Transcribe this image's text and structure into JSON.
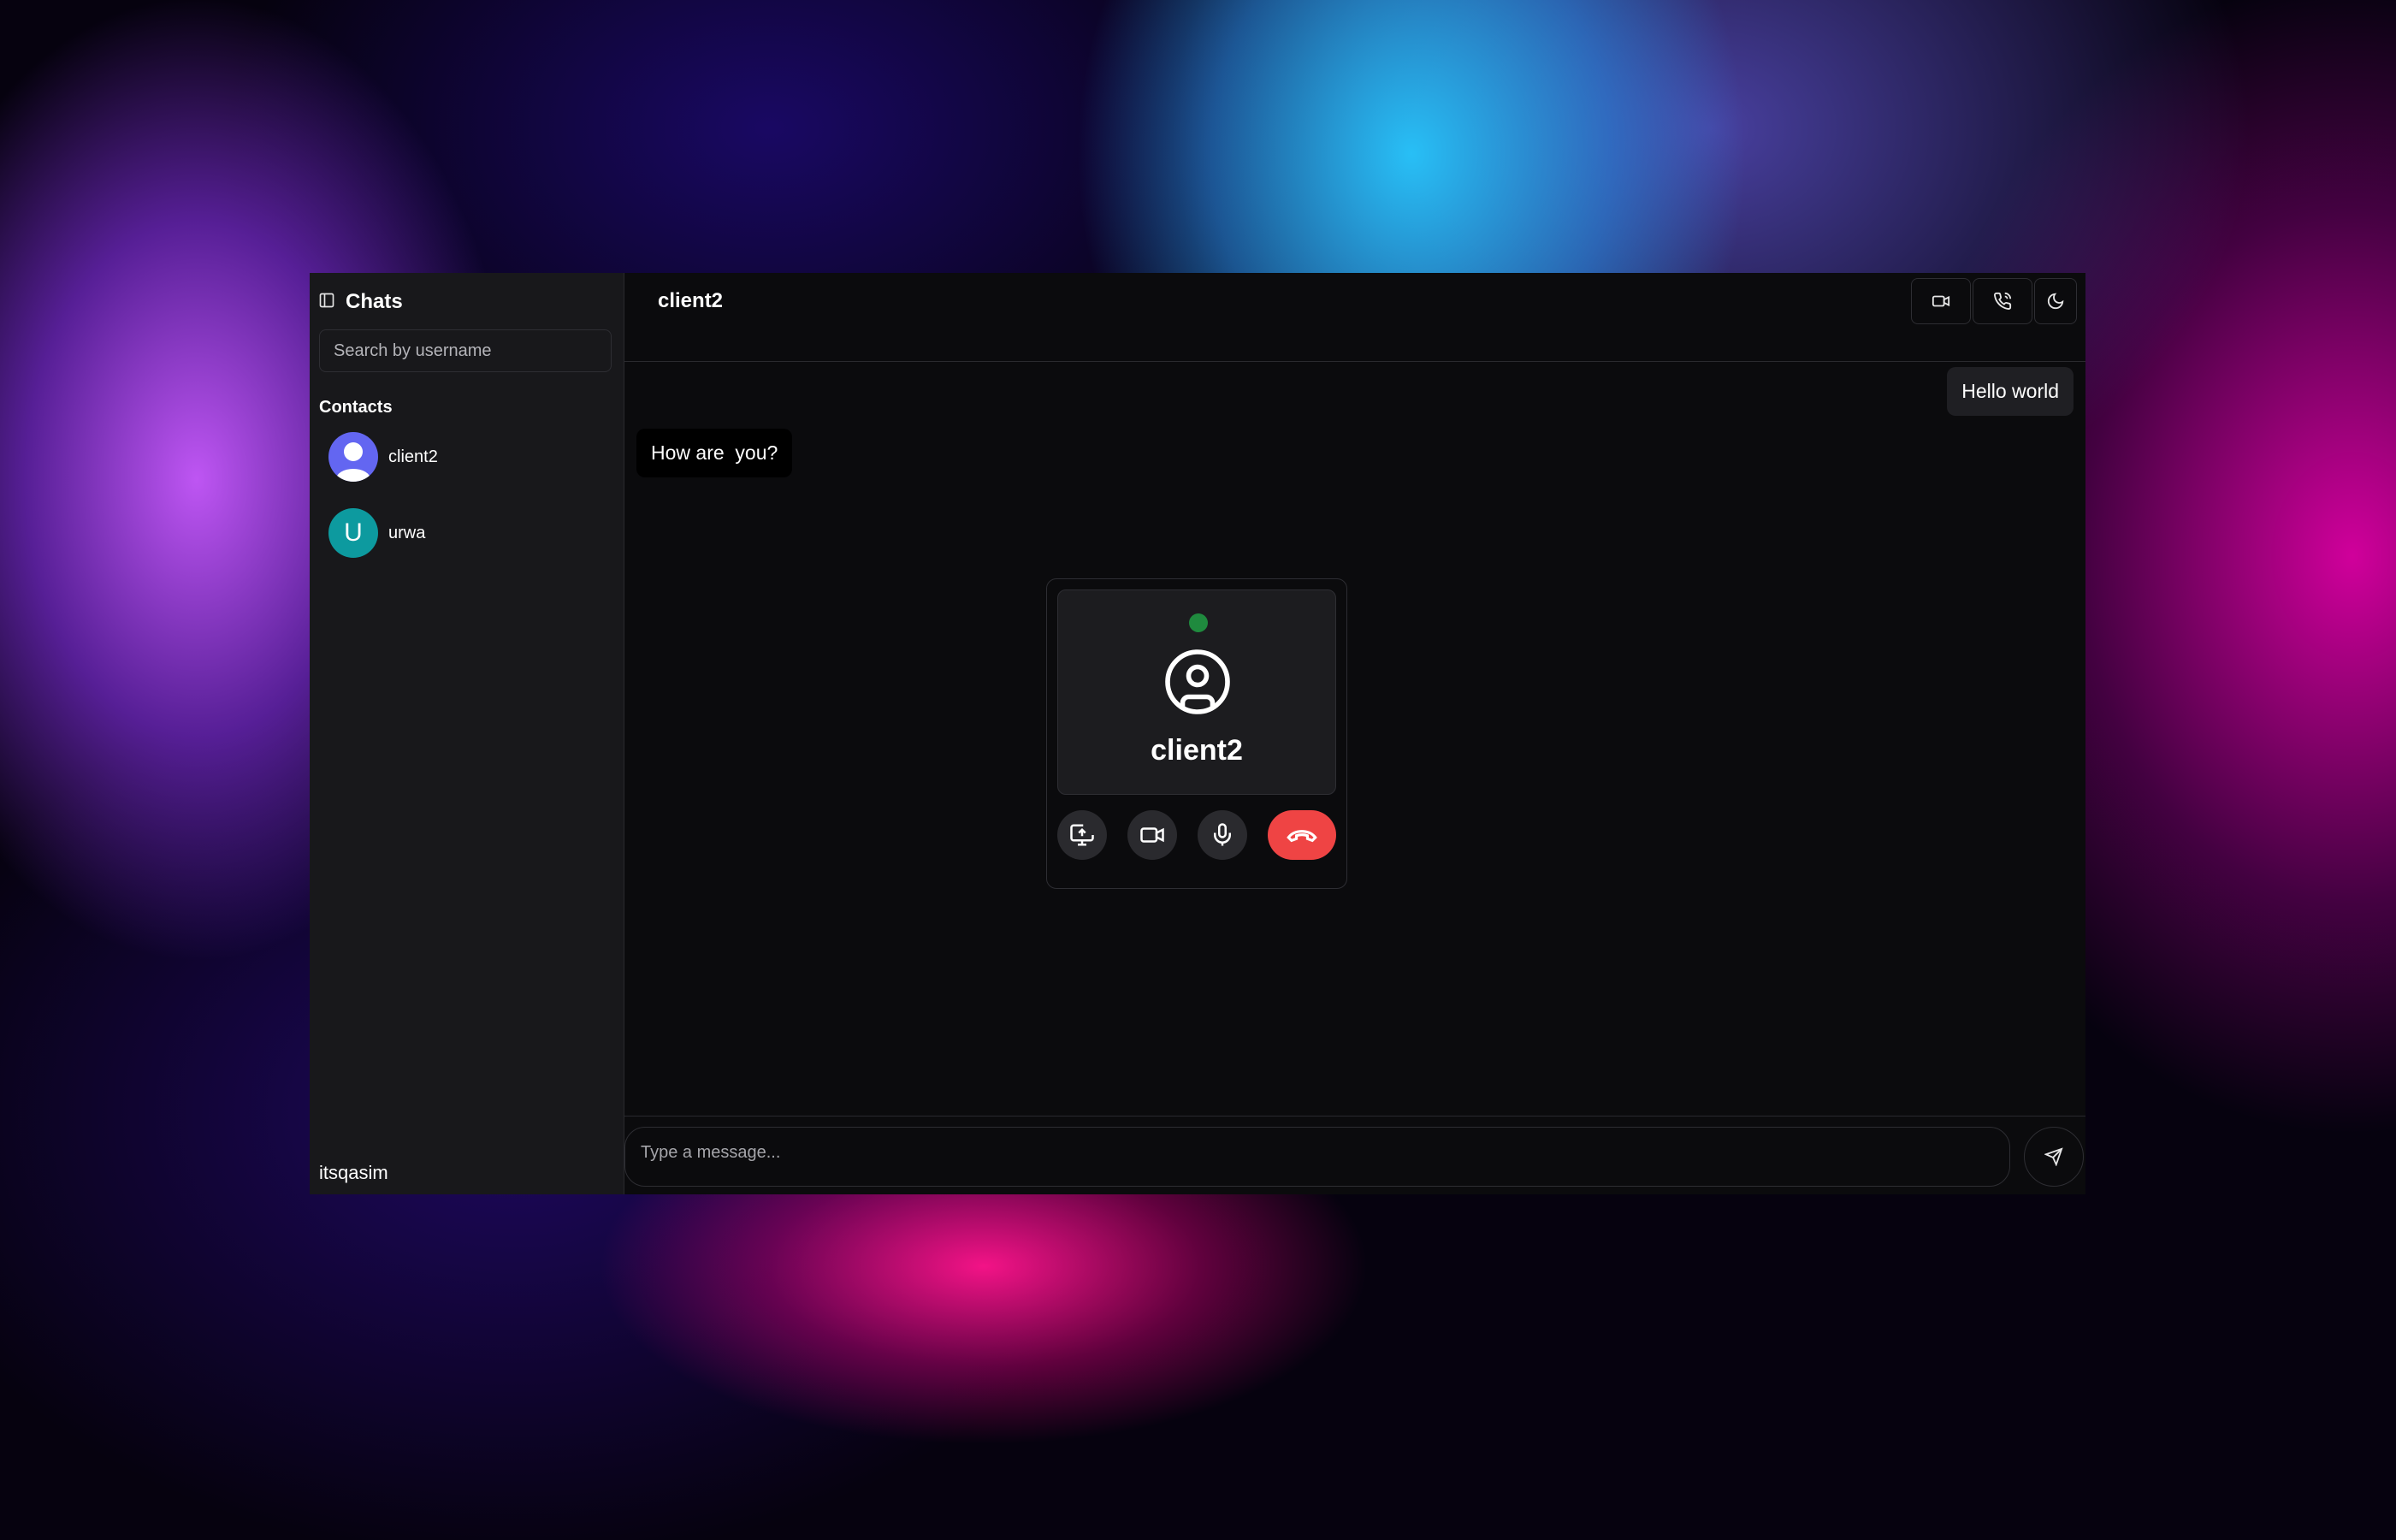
{
  "sidebar": {
    "title": "Chats",
    "search_placeholder": "Search by username",
    "contacts_label": "Contacts",
    "contacts": [
      {
        "name": "client2",
        "avatar": "default-user-avatar",
        "avatar_color": "#6366f1"
      },
      {
        "name": "urwa",
        "avatar_initial": "U",
        "avatar_color": "#0d9a9f"
      }
    ],
    "current_user": "itsqasim"
  },
  "chat": {
    "title": "client2",
    "header_buttons": [
      "video-call-icon",
      "phone-call-icon",
      "moon-icon"
    ],
    "messages": [
      {
        "text": "Hello world",
        "direction": "sent"
      },
      {
        "text": "How are  you?",
        "direction": "received"
      }
    ],
    "input_placeholder": "Type a message..."
  },
  "call": {
    "name": "client2",
    "status_color": "#1f8a3e",
    "controls": [
      "share-screen-icon",
      "video-icon",
      "microphone-icon",
      "end-call-icon"
    ],
    "end_color": "#ef4444"
  }
}
